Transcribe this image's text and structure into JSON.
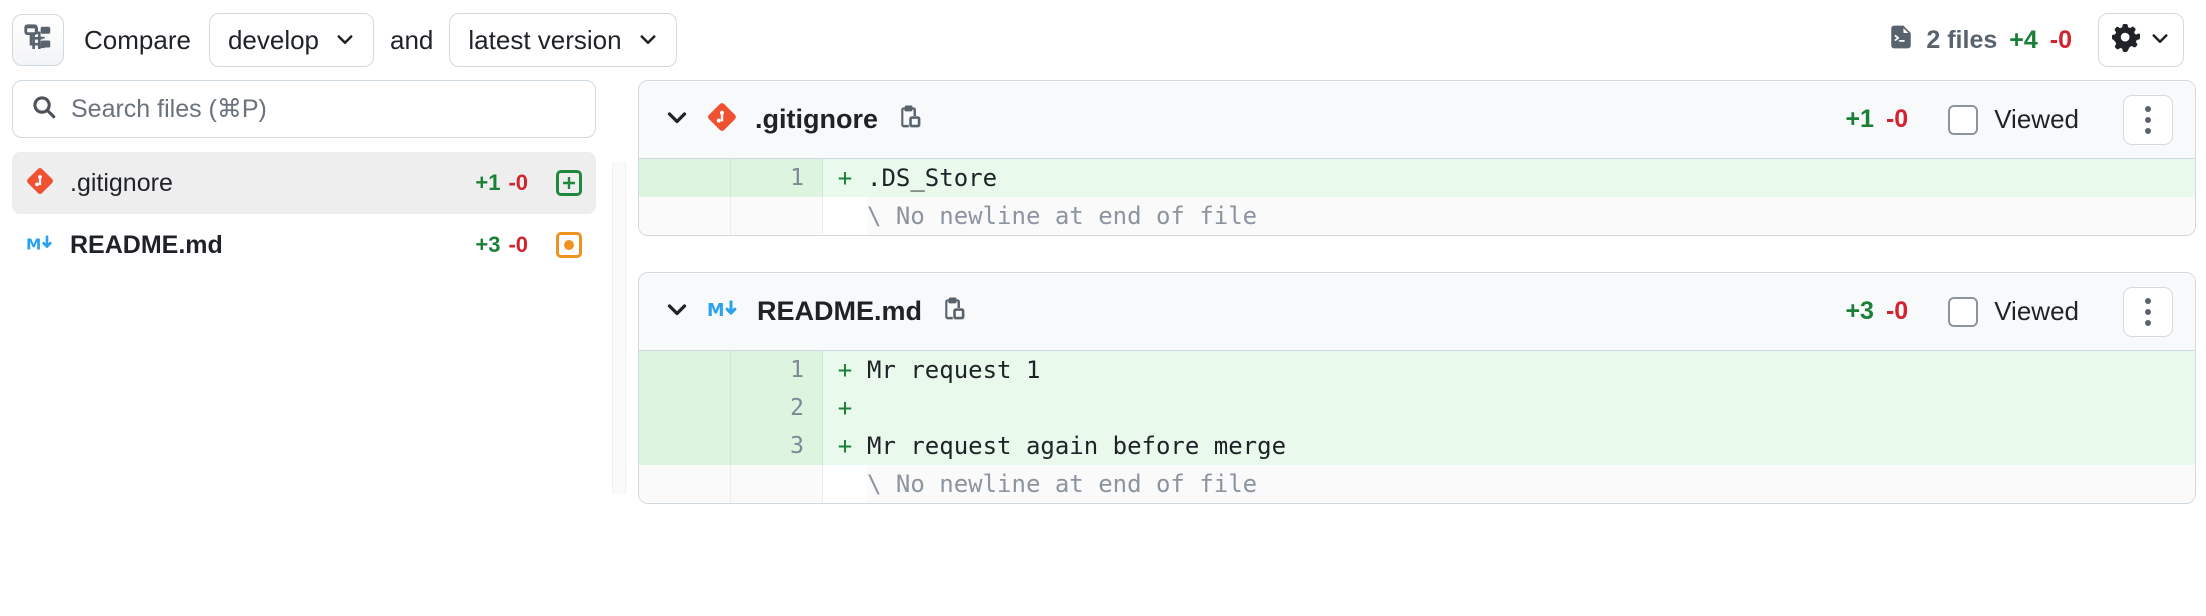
{
  "header": {
    "tree_toggle_icon": "file-tree-icon",
    "compare_label": "Compare",
    "source_ref": "develop",
    "and_label": "and",
    "target_ref": "latest version",
    "files_icon": "file-diff-icon",
    "files_count": "2 files",
    "additions": "+4",
    "deletions": "-0",
    "gear_icon": "gear-icon",
    "gear_chevron_icon": "chevron-down-icon"
  },
  "sidebar": {
    "search": {
      "icon": "search-icon",
      "placeholder": "Search files (⌘P)",
      "value": ""
    },
    "files": [
      {
        "icon": "git-file-icon",
        "name": ".gitignore",
        "additions": "+1",
        "deletions": "-0",
        "status_icon": "file-added-icon",
        "selected": true,
        "bold": false
      },
      {
        "icon": "markdown-file-icon",
        "name": "README.md",
        "additions": "+3",
        "deletions": "-0",
        "status_icon": "file-modified-icon",
        "selected": false,
        "bold": true
      }
    ]
  },
  "diffs": [
    {
      "collapse_icon": "chevron-down-icon",
      "file_icon": "git-file-icon",
      "title": ".gitignore",
      "copy_icon": "copy-icon",
      "additions": "+1",
      "deletions": "-0",
      "viewed_label": "Viewed",
      "viewed_checked": false,
      "menu_icon": "kebab-menu-icon",
      "lines": [
        {
          "type": "add",
          "old_no": "",
          "new_no": "1",
          "sign": "+",
          "text": ".DS_Store"
        },
        {
          "type": "note",
          "old_no": "",
          "new_no": "",
          "sign": "",
          "text": "\\ No newline at end of file"
        }
      ]
    },
    {
      "collapse_icon": "chevron-down-icon",
      "file_icon": "markdown-file-icon",
      "title": "README.md",
      "copy_icon": "copy-icon",
      "additions": "+3",
      "deletions": "-0",
      "viewed_label": "Viewed",
      "viewed_checked": false,
      "menu_icon": "kebab-menu-icon",
      "lines": [
        {
          "type": "add",
          "old_no": "",
          "new_no": "1",
          "sign": "+",
          "text": "Mr request 1"
        },
        {
          "type": "add",
          "old_no": "",
          "new_no": "2",
          "sign": "+",
          "text": ""
        },
        {
          "type": "add",
          "old_no": "",
          "new_no": "3",
          "sign": "+",
          "text": "Mr request again before merge"
        },
        {
          "type": "note",
          "old_no": "",
          "new_no": "",
          "sign": "",
          "text": "\\ No newline at end of file"
        }
      ]
    }
  ],
  "colors": {
    "addition_green": "#1a7f37",
    "deletion_red": "#d1242f",
    "diff_gutter_green": "#ddf4e0",
    "diff_body_green": "#e9f9ec",
    "border": "#d1d9e0",
    "git_orange": "#f05133",
    "markdown_blue": "#2aa3ef",
    "modified_orange": "#f0921f"
  }
}
